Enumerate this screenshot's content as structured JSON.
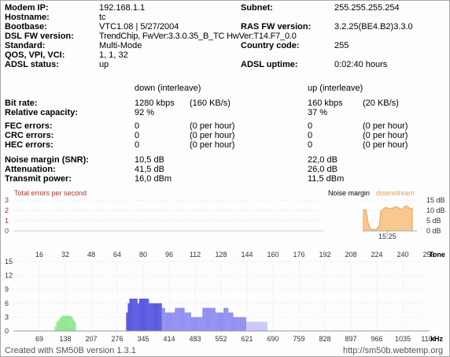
{
  "info": {
    "modem_ip_label": "Modem IP:",
    "modem_ip": "192.168.1.1",
    "hostname_label": "Hostname:",
    "hostname": "tc",
    "bootbase_label": "Bootbase:",
    "bootbase": "VTC1.08 | 5/27/2004",
    "dsl_fw_label": "DSL FW version:",
    "dsl_fw": "TrendChip, FwVer:3.3.0.35_B_TC HwVer:T14.F7_0.0",
    "standard_label": "Standard:",
    "standard": "Multi-Mode",
    "qos_label": "QOS, VPI, VCI:",
    "qos": "1, 1, 32",
    "adsl_status_label": "ADSL status:",
    "adsl_status": "up",
    "subnet_label": "Subnet:",
    "subnet": "255.255.255.254",
    "ras_fw_label": "RAS FW version:",
    "ras_fw": "3.2.25(BE4.B2)3.3.0",
    "country_label": "Country code:",
    "country": "255",
    "uptime_label": "ADSL uptime:",
    "uptime": "0:02:40 hours"
  },
  "stats": {
    "down_header": "down (interleave)",
    "up_header": "up (interleave)",
    "bitrate_label": "Bit rate:",
    "down_bitrate": "1280 kbps",
    "down_bitrate_kb": "(160 KB/s)",
    "up_bitrate": "160 kbps",
    "up_bitrate_kb": "(20 KB/s)",
    "capacity_label": "Relative capacity:",
    "down_capacity": "92 %",
    "up_capacity": "37 %",
    "fec_label": "FEC errors:",
    "crc_label": "CRC errors:",
    "hec_label": "HEC errors:",
    "down_fec": "0",
    "down_fec_rate": "(0 per hour)",
    "down_crc": "0",
    "down_crc_rate": "(0 per hour)",
    "down_hec": "0",
    "down_hec_rate": "(0 per hour)",
    "up_fec": "0",
    "up_fec_rate": "(0 per hour)",
    "up_crc": "0",
    "up_crc_rate": "(0 per hour)",
    "up_hec": "0",
    "up_hec_rate": "(0 per hour)",
    "snr_label": "Noise margin (SNR):",
    "down_snr": "10,5 dB",
    "up_snr": "22,0 dB",
    "atten_label": "Attenuation:",
    "down_atten": "41,5 dB",
    "up_atten": "26,0 dB",
    "tx_label": "Transmit power:",
    "down_tx": "16,0 dBm",
    "up_tx": "11,5 dBm"
  },
  "colors": {
    "errors_title": "#a33333",
    "downstream": "#e8a050",
    "downstream_fill": "#f8c890",
    "upstream_tones": "#90e890",
    "downstream_tones_dark": "#5a5ae0",
    "downstream_tones_mid": "#9090f0",
    "downstream_tones_light": "#c8c8f8"
  },
  "errors_chart": {
    "title": "Total errors per second",
    "y_ticks": [
      "3",
      "2",
      "1",
      "0"
    ]
  },
  "noise_chart": {
    "legend_noise": "Noise margin",
    "legend_downstream": "downstream",
    "y_ticks": [
      "15 dB",
      "10 dB",
      "5 dB",
      "0 dB"
    ],
    "time_label": "15:25"
  },
  "chart_data": {
    "type": "bar",
    "title": "",
    "top_axis_label": "Tone",
    "top_ticks": [
      "16",
      "32",
      "48",
      "64",
      "80",
      "96",
      "112",
      "128",
      "144",
      "160",
      "176",
      "192",
      "208",
      "224",
      "240",
      "256"
    ],
    "xlabel": "kHz",
    "x_ticks": [
      "69",
      "138",
      "207",
      "276",
      "345",
      "414",
      "483",
      "552",
      "621",
      "690",
      "759",
      "828",
      "897",
      "966",
      "1035",
      "1104"
    ],
    "y_ticks": [
      "15",
      "12",
      "9",
      "6",
      "3",
      "0"
    ],
    "ylim": [
      0,
      15
    ],
    "xlim_tone": [
      0,
      256
    ],
    "series": [
      {
        "values": [
          [
            26,
            1
          ],
          [
            27,
            2
          ],
          [
            28,
            2.3
          ],
          [
            29,
            2.8
          ],
          [
            30,
            3.2
          ],
          [
            31,
            3.3
          ],
          [
            32,
            3.3
          ],
          [
            33,
            3.3
          ],
          [
            34,
            3.3
          ],
          [
            35,
            3.3
          ],
          [
            36,
            3
          ],
          [
            37,
            2.5
          ],
          [
            38,
            2
          ]
        ]
      },
      {
        "values": [
          [
            70,
            4
          ],
          [
            71,
            6
          ],
          [
            72,
            7
          ],
          [
            73,
            7
          ],
          [
            74,
            7
          ],
          [
            75,
            7
          ],
          [
            76,
            7
          ],
          [
            77,
            6
          ],
          [
            78,
            7
          ],
          [
            79,
            7
          ],
          [
            80,
            7
          ],
          [
            81,
            7
          ],
          [
            82,
            7
          ],
          [
            83,
            7
          ],
          [
            84,
            6
          ],
          [
            85,
            6
          ],
          [
            86,
            6
          ],
          [
            87,
            6
          ],
          [
            88,
            6
          ],
          [
            89,
            6
          ],
          [
            90,
            6
          ],
          [
            91,
            6
          ],
          [
            92,
            5
          ],
          [
            93,
            5
          ],
          [
            94,
            4
          ],
          [
            95,
            4
          ],
          [
            96,
            4
          ],
          [
            97,
            4
          ],
          [
            98,
            4
          ],
          [
            99,
            4
          ],
          [
            100,
            5
          ],
          [
            101,
            5
          ],
          [
            102,
            5
          ],
          [
            103,
            5
          ],
          [
            104,
            5
          ],
          [
            105,
            5
          ],
          [
            106,
            4
          ],
          [
            107,
            4
          ],
          [
            108,
            4
          ],
          [
            109,
            4
          ],
          [
            110,
            3
          ],
          [
            111,
            3
          ],
          [
            112,
            3
          ],
          [
            113,
            3
          ],
          [
            114,
            3
          ],
          [
            115,
            3
          ],
          [
            116,
            3
          ],
          [
            117,
            5
          ],
          [
            118,
            5
          ],
          [
            119,
            5
          ],
          [
            120,
            5
          ],
          [
            121,
            5
          ],
          [
            122,
            5
          ],
          [
            123,
            5
          ],
          [
            124,
            5
          ],
          [
            125,
            4
          ],
          [
            126,
            4
          ],
          [
            127,
            4
          ],
          [
            128,
            4
          ],
          [
            129,
            4
          ],
          [
            130,
            5
          ],
          [
            131,
            5
          ],
          [
            132,
            5
          ],
          [
            133,
            4
          ],
          [
            134,
            4
          ],
          [
            135,
            4
          ],
          [
            136,
            3
          ],
          [
            137,
            3
          ],
          [
            138,
            3
          ],
          [
            139,
            3
          ],
          [
            140,
            3
          ],
          [
            141,
            3
          ],
          [
            142,
            3
          ],
          [
            143,
            3
          ],
          [
            144,
            2
          ],
          [
            145,
            2
          ],
          [
            146,
            2
          ],
          [
            147,
            2
          ],
          [
            148,
            2
          ],
          [
            149,
            2
          ],
          [
            150,
            2
          ],
          [
            151,
            2
          ],
          [
            152,
            2
          ],
          [
            153,
            2
          ],
          [
            154,
            2
          ],
          [
            155,
            2
          ],
          [
            156,
            2
          ]
        ]
      }
    ]
  },
  "footer": {
    "created": "Created with SM50B version 1.3.1",
    "url": "http://sm50b.webtemp.org"
  }
}
